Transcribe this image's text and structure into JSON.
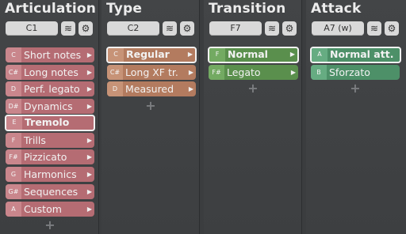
{
  "panels": [
    {
      "title": "Articulation",
      "key": "C1",
      "items": [
        {
          "key": "C",
          "label": "Short notes"
        },
        {
          "key": "C#",
          "label": "Long notes"
        },
        {
          "key": "D",
          "label": "Perf. legato"
        },
        {
          "key": "D#",
          "label": "Dynamics"
        },
        {
          "key": "E",
          "label": "Tremolo",
          "selected": true
        },
        {
          "key": "F",
          "label": "Trills"
        },
        {
          "key": "F#",
          "label": "Pizzicato"
        },
        {
          "key": "G",
          "label": "Harmonics"
        },
        {
          "key": "G#",
          "label": "Sequences"
        },
        {
          "key": "A",
          "label": "Custom"
        }
      ]
    },
    {
      "title": "Type",
      "key": "C2",
      "items": [
        {
          "key": "C",
          "label": "Regular",
          "selected": true
        },
        {
          "key": "C#",
          "label": "Long XF tr."
        },
        {
          "key": "D",
          "label": "Measured"
        }
      ]
    },
    {
      "title": "Transition",
      "key": "F7",
      "items": [
        {
          "key": "F",
          "label": "Normal",
          "selected": true
        },
        {
          "key": "F#",
          "label": "Legato"
        }
      ]
    },
    {
      "title": "Attack",
      "key": "A7 (w)",
      "items": [
        {
          "key": "A",
          "label": "Normal att.",
          "selected": true
        },
        {
          "key": "B",
          "label": "Sforzato"
        }
      ]
    }
  ],
  "icons": {
    "layers": "layers-icon",
    "settings": "gear-icon",
    "add": "plus-icon",
    "arrow": "triangle-right-icon"
  },
  "glyphs": {
    "layers": "≋",
    "settings": "⚙",
    "add": "+",
    "arrow": "▶"
  },
  "colors": {
    "articulation": "#b56c73",
    "type": "#b37b5f",
    "transition": "#5a8f4d",
    "attack": "#4d9068",
    "background": "#3b3d3f"
  }
}
